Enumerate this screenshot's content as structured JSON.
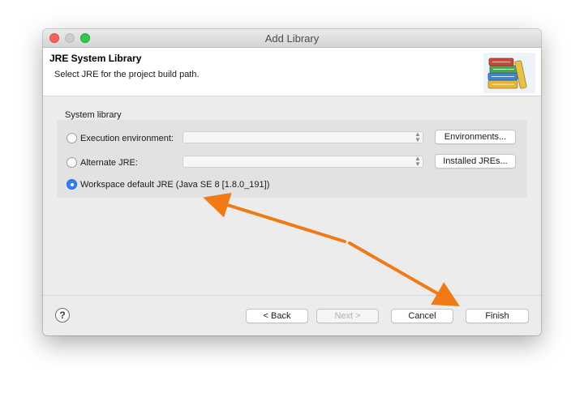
{
  "window": {
    "title": "Add Library"
  },
  "header": {
    "title": "JRE System Library",
    "description": "Select JRE for the project build path.",
    "icon": "library-books-icon"
  },
  "system_library": {
    "group_label": "System library",
    "options": [
      {
        "label": "Execution environment:",
        "selected": false,
        "combo_value": "",
        "button_label": "Environments..."
      },
      {
        "label": "Alternate JRE:",
        "selected": false,
        "combo_value": "",
        "button_label": "Installed JREs..."
      },
      {
        "label": "Workspace default JRE (Java SE 8 [1.8.0_191])",
        "selected": true
      }
    ]
  },
  "footer": {
    "help_icon": "help-icon",
    "help_glyph": "?",
    "back_label": "< Back",
    "next_label": "Next >",
    "cancel_label": "Cancel",
    "finish_label": "Finish"
  },
  "annotation": {
    "arrow_color": "#f07b16"
  },
  "colors": {
    "accent": "#2f7ff8",
    "close": "#fc605c",
    "zoom": "#34c84a"
  }
}
